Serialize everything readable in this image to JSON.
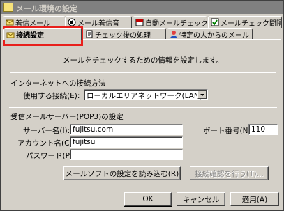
{
  "window": {
    "title": "メール環境の設定"
  },
  "tabs_back": [
    {
      "label": "着信メール"
    },
    {
      "label": "メール着信音"
    },
    {
      "label": "自動メールチェック"
    },
    {
      "label": "メールチェック間隔"
    }
  ],
  "tabs_front": [
    {
      "label": "接続設定"
    },
    {
      "label": "チェック後の処理"
    },
    {
      "label": "特定の人からのメール"
    }
  ],
  "info_text": "メールをチェックするための情報を設定します。",
  "internet": {
    "group_label": "インターネットへの接続方法",
    "connection_label": "使用する接続(E):",
    "connection_value": "ローカルエリアネットワーク(LAN)"
  },
  "pop3": {
    "group_label": "受信メールサーバー(POP3)の設定",
    "server_label": "サーバー名(I):",
    "server_value": "fujitsu.com",
    "account_label": "アカウント名(C):",
    "account_value": "fujitsu",
    "password_label": "パスワード(P):",
    "password_value": "",
    "port_label": "ポート番号(N):",
    "port_value": "110"
  },
  "buttons": {
    "import": "メールソフトの設定を読み込む(R)",
    "test": "接続確認を行う(T)...",
    "ok": "OK",
    "cancel": "キャンセル",
    "apply": "適用(A)"
  },
  "colors": {
    "highlight": "#e8201c",
    "dialog_bg": "#d4d0c8"
  }
}
